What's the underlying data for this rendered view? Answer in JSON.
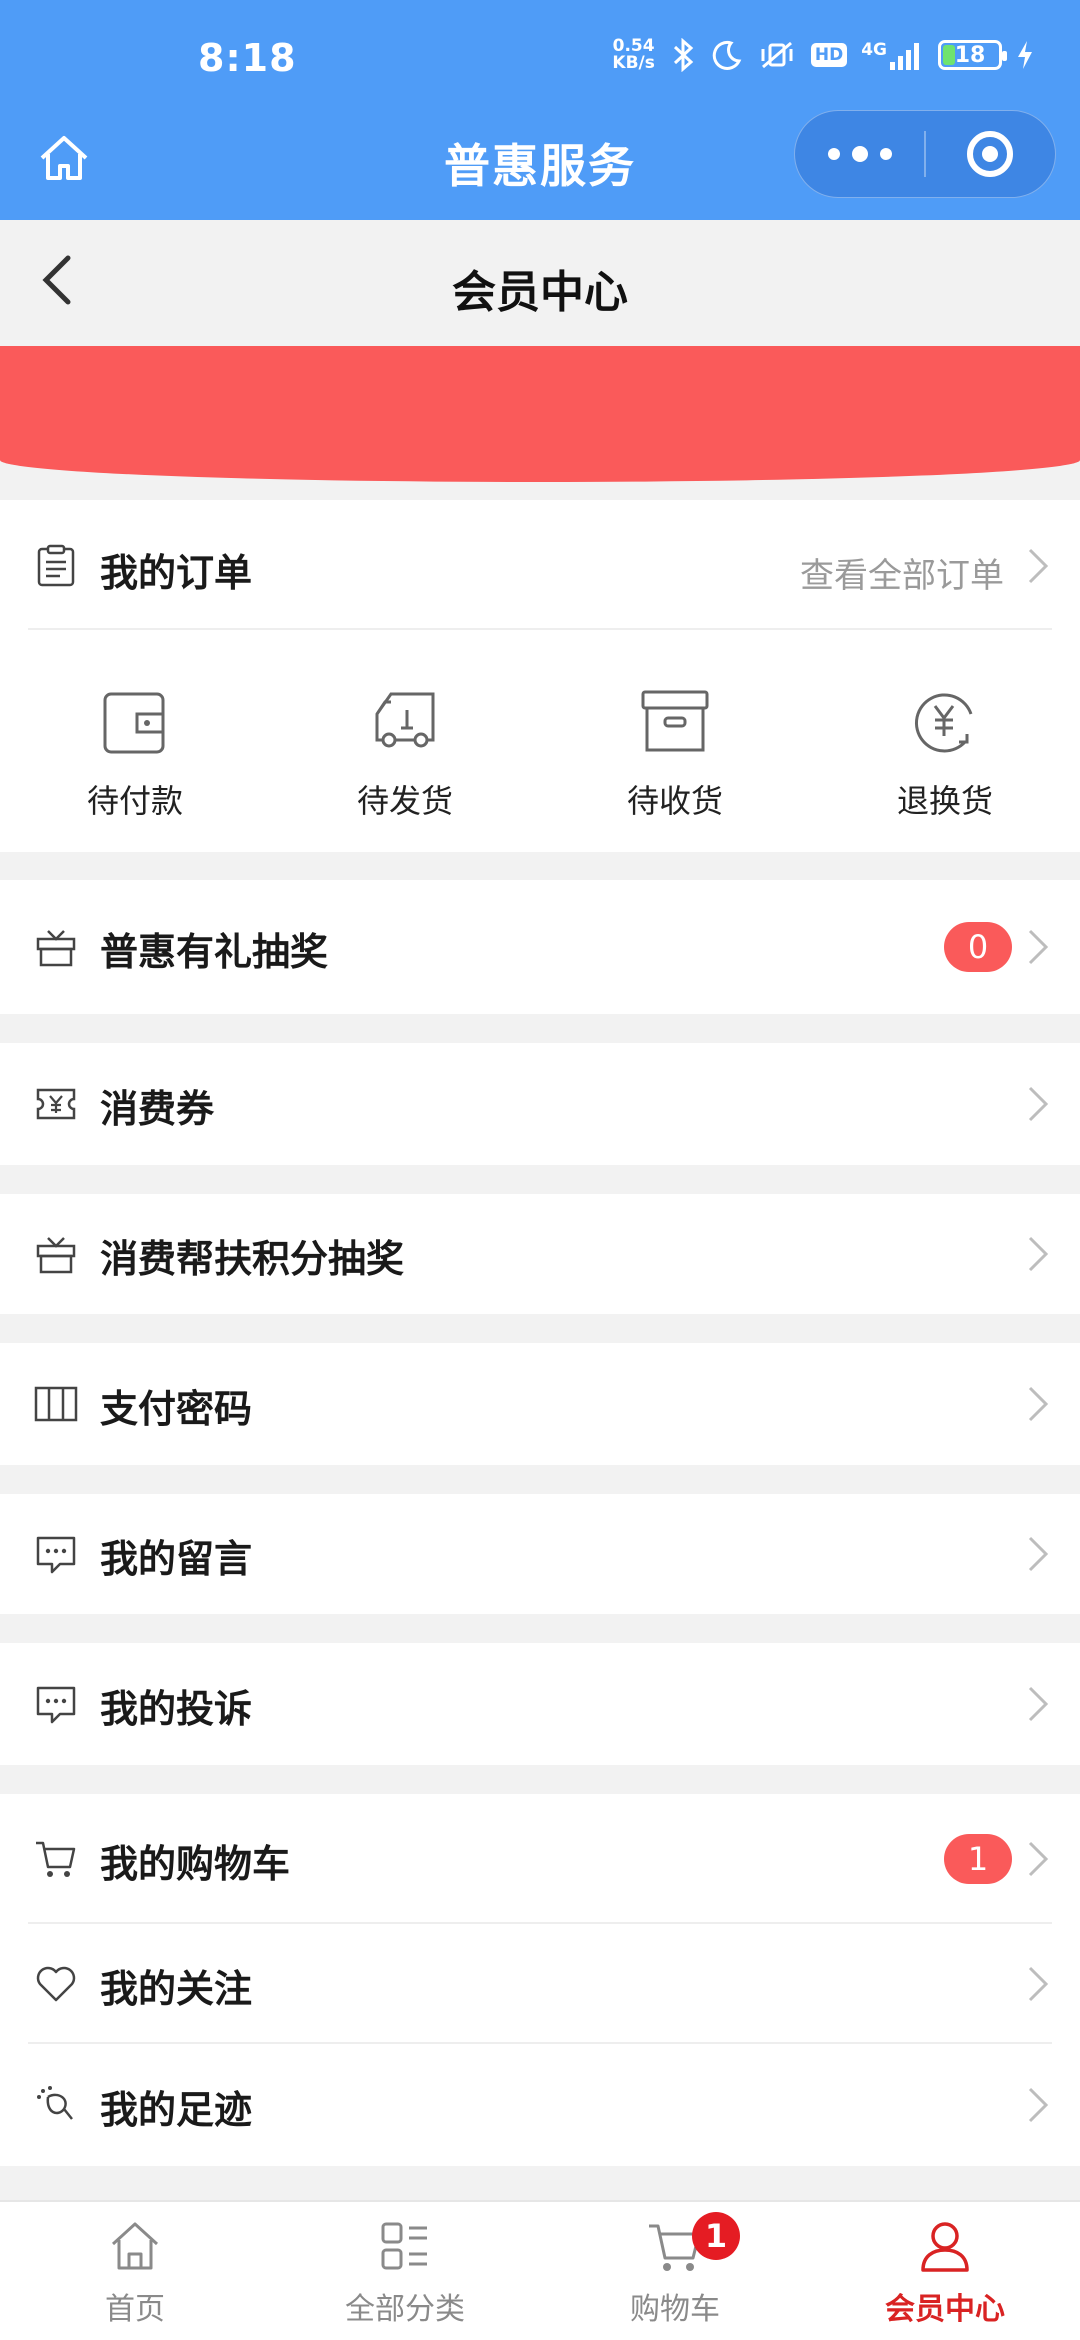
{
  "status_bar": {
    "time": "8:18",
    "net_speed_value": "0.54",
    "net_speed_unit": "KB/s",
    "network": "4G",
    "hd": "HD",
    "battery": "18"
  },
  "nav": {
    "title": "普惠服务"
  },
  "page": {
    "title": "会员中心"
  },
  "orders": {
    "title": "我的订单",
    "view_all": "查看全部订单",
    "items": [
      {
        "label": "待付款",
        "icon": "wallet-icon"
      },
      {
        "label": "待发货",
        "icon": "truck-icon"
      },
      {
        "label": "待收货",
        "icon": "box-icon"
      },
      {
        "label": "退换货",
        "icon": "yen-refund-icon"
      }
    ]
  },
  "menu": {
    "lottery": {
      "label": "普惠有礼抽奖",
      "badge": "0",
      "icon": "gift-icon"
    },
    "coupons": {
      "label": "消费券",
      "icon": "coupon-icon"
    },
    "points_lottery": {
      "label": "消费帮扶积分抽奖",
      "icon": "gift-icon"
    },
    "pay_password": {
      "label": "支付密码",
      "icon": "password-icon"
    },
    "messages": {
      "label": "我的留言",
      "icon": "message-icon"
    },
    "complaints": {
      "label": "我的投诉",
      "icon": "message-icon"
    },
    "cart": {
      "label": "我的购物车",
      "badge": "1",
      "icon": "cart-icon"
    },
    "favorites": {
      "label": "我的关注",
      "icon": "heart-icon"
    },
    "footprints": {
      "label": "我的足迹",
      "icon": "footprint-icon"
    }
  },
  "tabbar": {
    "home": "首页",
    "categories": "全部分类",
    "cart": "购物车",
    "cart_badge": "1",
    "member": "会员中心"
  },
  "colors": {
    "nav_blue": "#4f9cf7",
    "banner_red": "#fa5a5a",
    "active_tab_red": "#d92323"
  }
}
